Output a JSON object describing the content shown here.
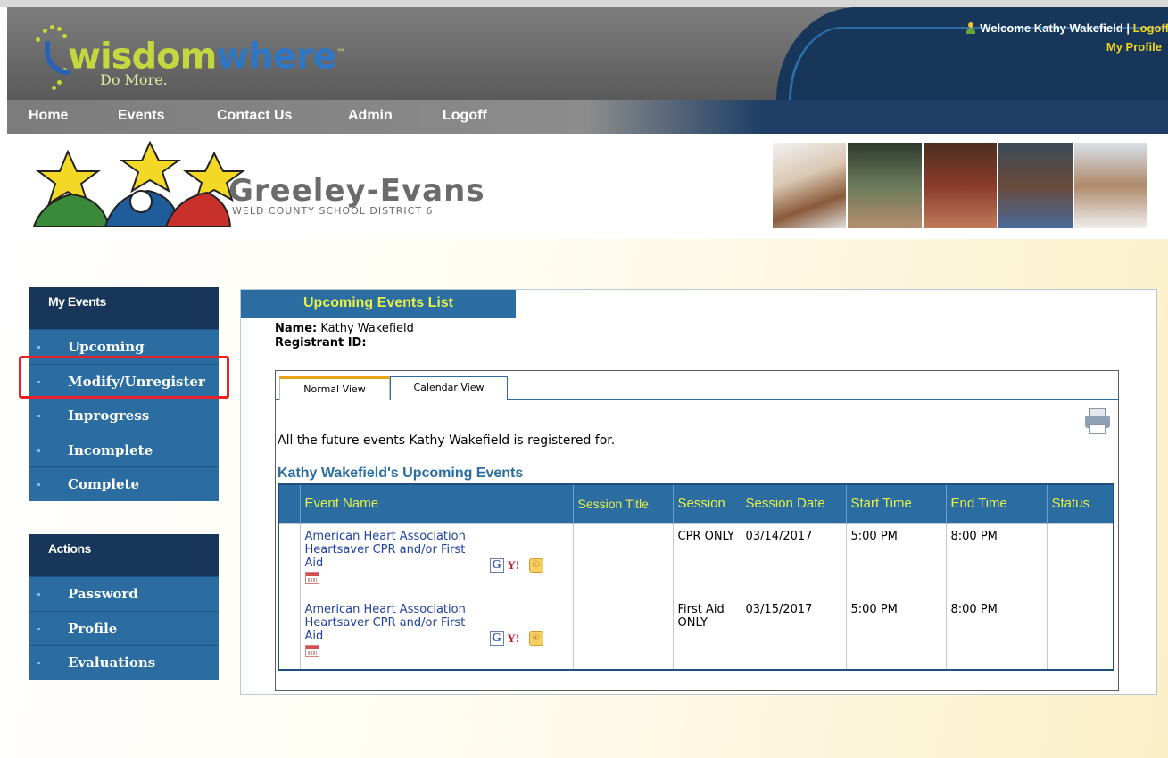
{
  "brand": {
    "logo_word_part1": "wisdom",
    "logo_word_part2": "where",
    "logo_tm": "™",
    "tagline": "Do More."
  },
  "header": {
    "welcome_text": "Welcome Kathy Wakefield",
    "separator": "|",
    "logoff_label": "Logoff",
    "my_profile_label": "My Profile"
  },
  "nav": {
    "items": [
      {
        "label": "Home"
      },
      {
        "label": "Events"
      },
      {
        "label": "Contact Us"
      },
      {
        "label": "Admin"
      },
      {
        "label": "Logoff"
      }
    ]
  },
  "district": {
    "name": "Greeley-Evans",
    "subtitle": "WELD COUNTY SCHOOL DISTRICT 6"
  },
  "sidebar": {
    "my_events": {
      "title": "My Events",
      "items": [
        {
          "label": "Upcoming"
        },
        {
          "label": "Modify/Unregister"
        },
        {
          "label": "Inprogress"
        },
        {
          "label": "Incomplete"
        },
        {
          "label": "Complete"
        }
      ]
    },
    "actions": {
      "title": "Actions",
      "items": [
        {
          "label": "Password"
        },
        {
          "label": "Profile"
        },
        {
          "label": "Evaluations"
        }
      ]
    }
  },
  "content": {
    "title": "Upcoming Events List",
    "name_label": "Name:",
    "name_value": "Kathy Wakefield",
    "registrant_label": "Registrant ID:",
    "tabs": [
      {
        "label": "Normal View"
      },
      {
        "label": "Calendar View"
      }
    ],
    "intro_text": "All the future events Kathy Wakefield is registered for.",
    "table_title": "Kathy Wakefield's Upcoming Events",
    "columns": [
      "Event Name",
      "Session Title",
      "Session",
      "Session Date",
      "Start Time",
      "End Time",
      "Status"
    ],
    "rows": [
      {
        "event_name": "American Heart Association Heartsaver CPR and/or First Aid",
        "session_title": "",
        "session": "CPR ONLY",
        "session_date": "03/14/2017",
        "start_time": "5:00 PM",
        "end_time": "8:00 PM",
        "status": ""
      },
      {
        "event_name": "American Heart Association Heartsaver CPR and/or First Aid",
        "session_title": "",
        "session": "First Aid ONLY",
        "session_date": "03/15/2017",
        "start_time": "5:00 PM",
        "end_time": "8:00 PM",
        "status": ""
      }
    ],
    "icons": {
      "google_calendar": "G",
      "yahoo_calendar": "Y!",
      "outlook_calendar": "☉"
    }
  },
  "colors": {
    "header_navy": "#17365a",
    "panel_blue": "#2b6da0",
    "header_text_yellow": "#e5f04a",
    "highlight_red": "#e8202a",
    "link_blue": "#1f3fa2"
  }
}
